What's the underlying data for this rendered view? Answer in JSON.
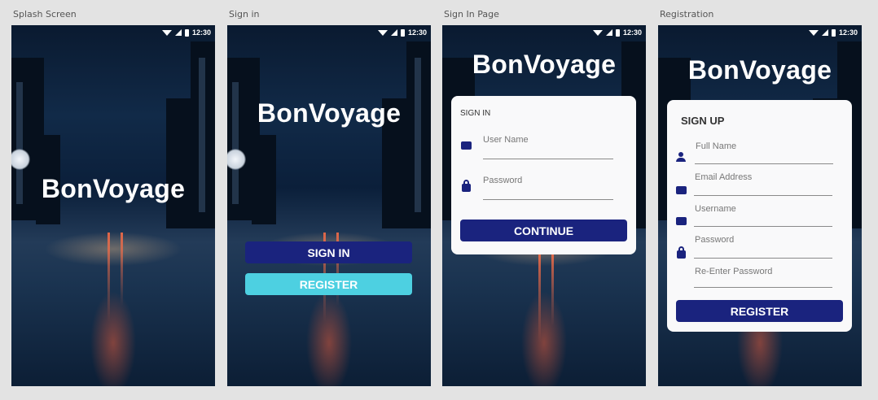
{
  "colors": {
    "primary": "#1a237e",
    "accent": "#4dd0e1",
    "card": "#f9f9fa"
  },
  "status_bar": {
    "time": "12:30",
    "icons": [
      "wifi-icon",
      "signal-icon",
      "battery-icon"
    ]
  },
  "app_name": "BonVoyage",
  "screens": {
    "splash": {
      "label": "Splash Screen"
    },
    "sign_in": {
      "label": "Sign in",
      "sign_in_button": "SIGN IN",
      "register_button": "REGISTER"
    },
    "sign_in_page": {
      "label": "Sign In Page",
      "card_title": "SIGN IN",
      "user_name_placeholder": "User Name",
      "password_placeholder": "Password",
      "continue_button": "CONTINUE"
    },
    "registration": {
      "label": "Registration",
      "card_title": "SIGN UP",
      "full_name_placeholder": "Full Name",
      "email_placeholder": "Email Address",
      "username_placeholder": "Username",
      "password_placeholder": "Password",
      "reenter_password_placeholder": "Re-Enter Password",
      "register_button": "REGISTER"
    }
  }
}
